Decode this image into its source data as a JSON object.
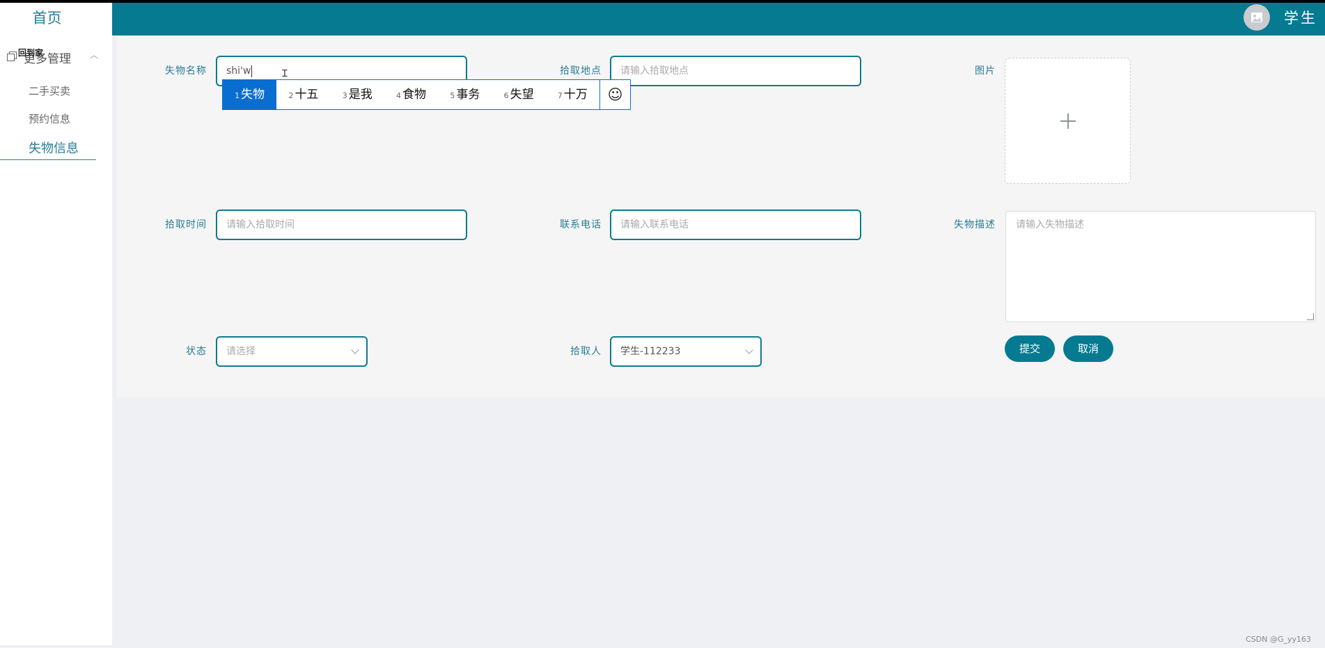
{
  "sidebar": {
    "home": "首页",
    "group": {
      "label": "更多管理",
      "overlay_text": "回到家"
    },
    "items": [
      {
        "label": "二手买卖"
      },
      {
        "label": "预约信息"
      },
      {
        "label": "失物信息"
      }
    ]
  },
  "header": {
    "username": "学生"
  },
  "form": {
    "name": {
      "label": "失物名称",
      "value": "shi'w"
    },
    "location": {
      "label": "拾取地点",
      "placeholder": "请输入拾取地点"
    },
    "image": {
      "label": "图片"
    },
    "time": {
      "label": "拾取时间",
      "placeholder": "请输入拾取时间"
    },
    "phone": {
      "label": "联系电话",
      "placeholder": "请输入联系电话"
    },
    "description": {
      "label": "失物描述",
      "placeholder": "请输入失物描述"
    },
    "status": {
      "label": "状态",
      "placeholder": "请选择"
    },
    "picker": {
      "label": "拾取人",
      "value": "学生-112233"
    },
    "submit_label": "提交",
    "cancel_label": "取消"
  },
  "ime": {
    "candidates": [
      {
        "num": "1",
        "text": "失物"
      },
      {
        "num": "2",
        "text": "十五"
      },
      {
        "num": "3",
        "text": "是我"
      },
      {
        "num": "4",
        "text": "食物"
      },
      {
        "num": "5",
        "text": "事务"
      },
      {
        "num": "6",
        "text": "失望"
      },
      {
        "num": "7",
        "text": "十万"
      }
    ],
    "emoji": "☺"
  },
  "watermark": "CSDN @G_yy163",
  "colors": {
    "primary": "#067a91",
    "accent": "#2a7d94",
    "ime_select": "#0a6ed1"
  }
}
